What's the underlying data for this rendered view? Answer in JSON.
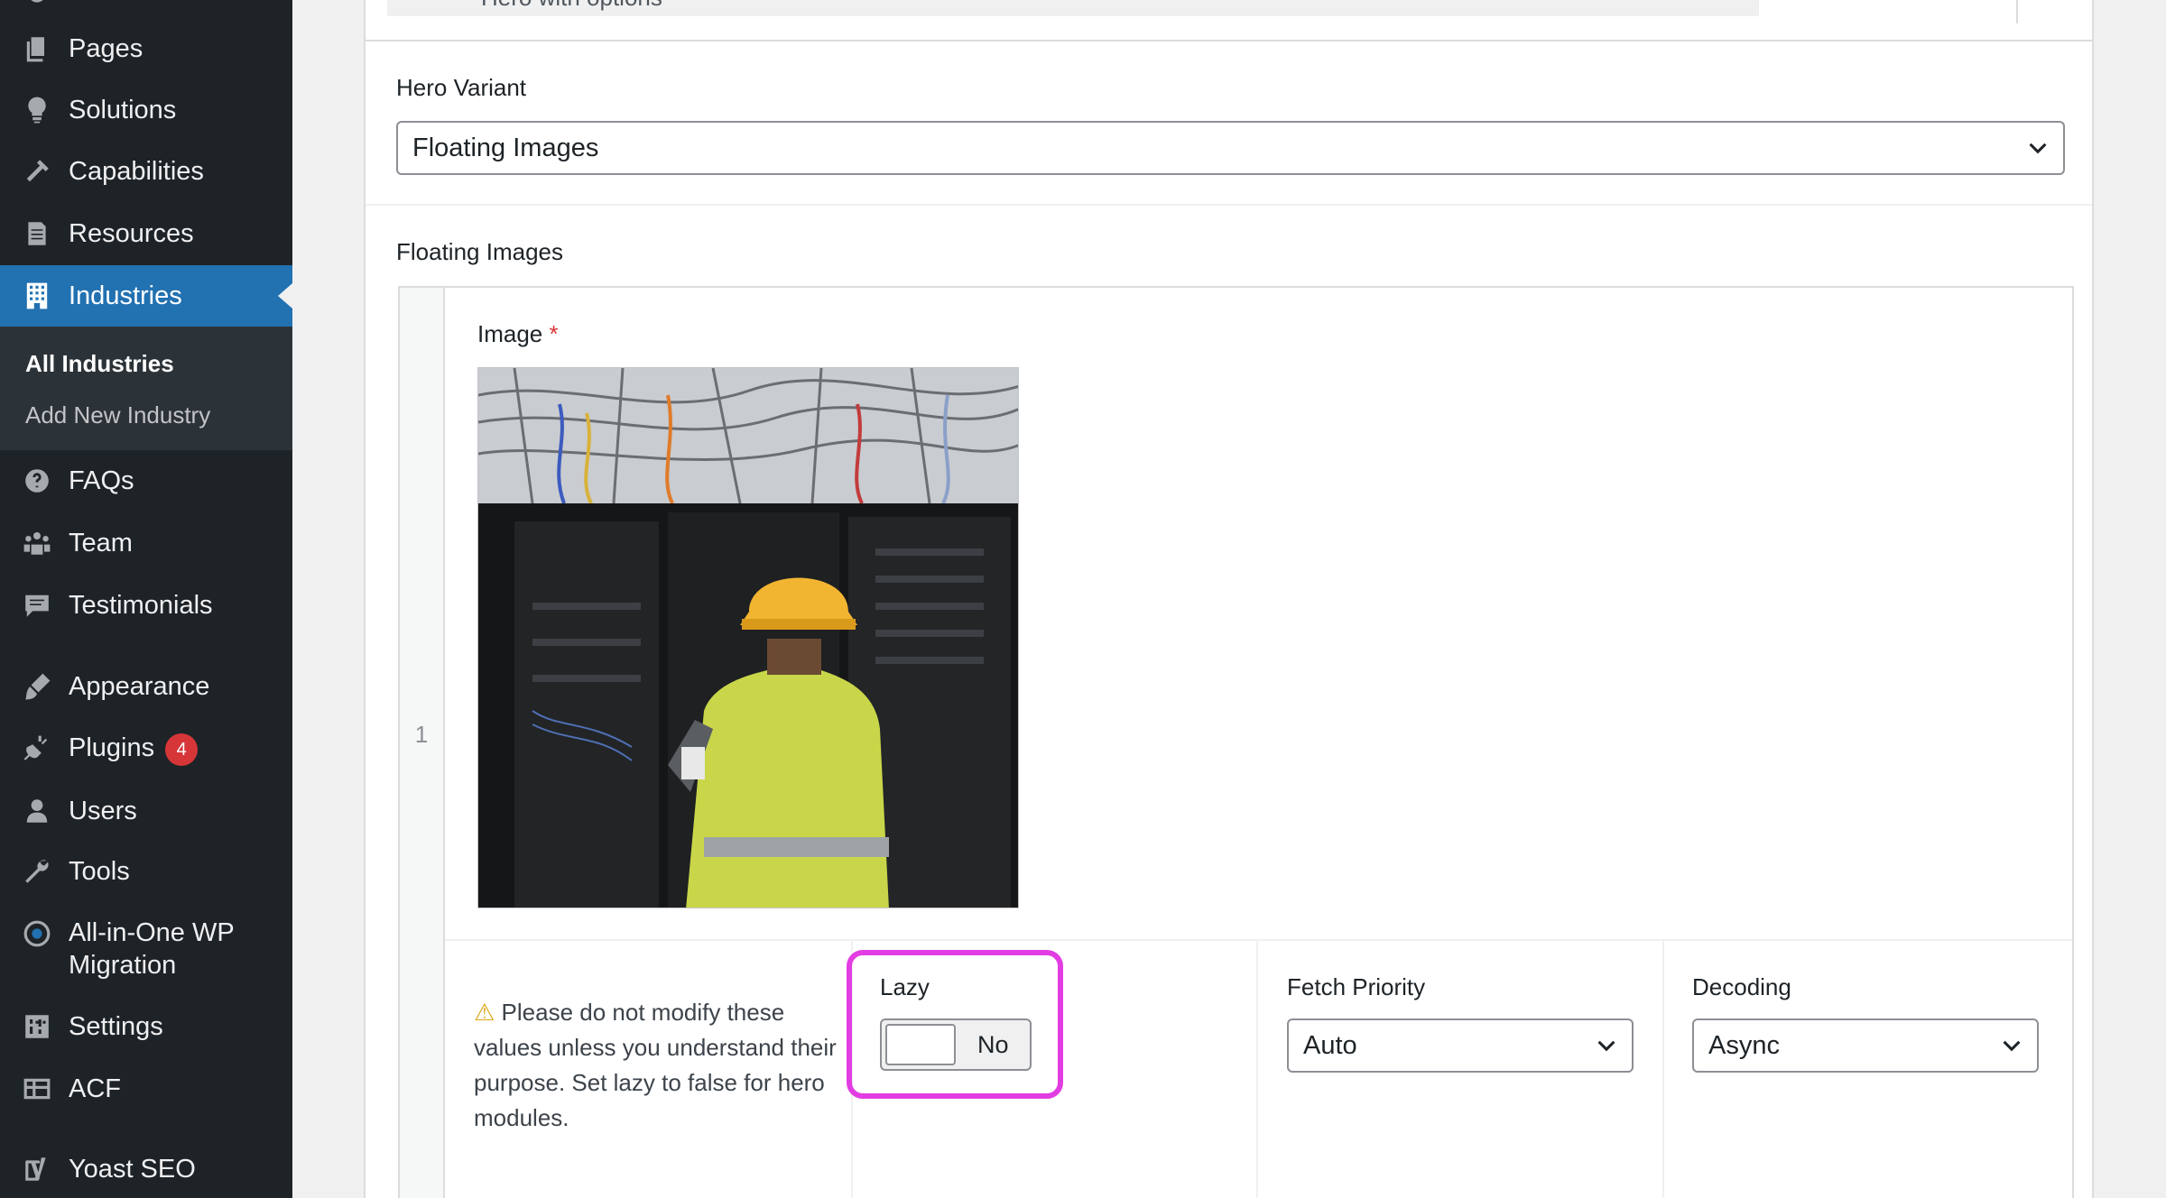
{
  "sidebar": {
    "items": [
      {
        "label": "Pages",
        "icon": "pages-icon"
      },
      {
        "label": "Solutions",
        "icon": "lightbulb-icon"
      },
      {
        "label": "Capabilities",
        "icon": "hammer-icon"
      },
      {
        "label": "Resources",
        "icon": "document-icon"
      },
      {
        "label": "Industries",
        "icon": "building-icon"
      },
      {
        "label": "FAQs",
        "icon": "question-icon"
      },
      {
        "label": "Team",
        "icon": "groups-icon"
      },
      {
        "label": "Testimonials",
        "icon": "testimonial-icon"
      },
      {
        "label": "Appearance",
        "icon": "brush-icon"
      },
      {
        "label": "Plugins",
        "icon": "plugin-icon",
        "badge": "4"
      },
      {
        "label": "Users",
        "icon": "user-icon"
      },
      {
        "label": "Tools",
        "icon": "wrench-icon"
      },
      {
        "label": "All-in-One WP",
        "label2": "Migration",
        "icon": "migration-icon"
      },
      {
        "label": "Settings",
        "icon": "settings-icon"
      },
      {
        "label": "ACF",
        "icon": "acf-icon"
      },
      {
        "label": "Yoast SEO",
        "icon": "yoast-icon"
      }
    ],
    "submenu": {
      "all": "All Industries",
      "add_new": "Add New Industry"
    }
  },
  "main": {
    "top_label": "Hero with options",
    "hero_variant": {
      "label": "Hero Variant",
      "value": "Floating Images"
    },
    "floating_images": {
      "label": "Floating Images",
      "row_number": "1",
      "image_label": "Image",
      "required_mark": "*",
      "warning_text": "Please do not modify these values unless you understand their purpose. Set lazy to false for hero modules.",
      "lazy": {
        "label": "Lazy",
        "value": "No"
      },
      "fetch_priority": {
        "label": "Fetch Priority",
        "value": "Auto"
      },
      "decoding": {
        "label": "Decoding",
        "value": "Async"
      }
    }
  },
  "colors": {
    "sidebar_bg": "#1d2327",
    "active_blue": "#2271b1",
    "badge_red": "#d63638",
    "highlight_magenta": "#e23de2"
  }
}
